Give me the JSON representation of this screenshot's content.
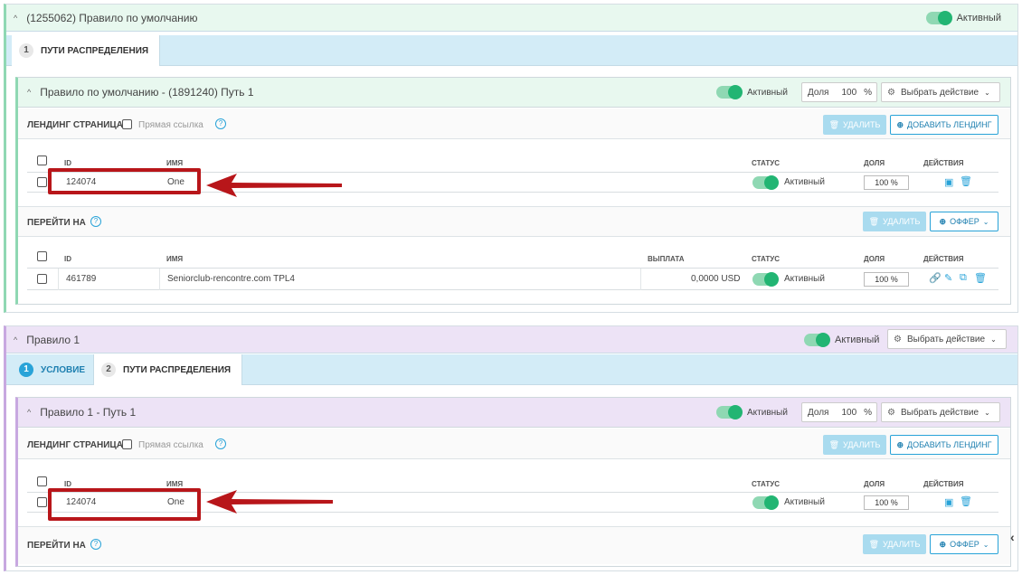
{
  "rule0": {
    "title": "(1255062) Правило по умолчанию",
    "status": "Активный",
    "tab1_num": "1",
    "tab1": "ПУТИ РАСПРЕДЕЛЕНИЯ",
    "path": {
      "title": "Правило по умолчанию - (1891240) Путь 1",
      "status": "Активный",
      "share_label": "Доля",
      "share_value": "100",
      "share_unit": "%",
      "action": "Выбрать действие",
      "landing_label": "ЛЕНДИНГ СТРАНИЦА",
      "direct_link": "Прямая ссылка",
      "delete": "УДАЛИТЬ",
      "add_landing": "ДОБАВИТЬ ЛЕНДИНГ",
      "landing_table": {
        "headers": {
          "id": "ID",
          "name": "ИМЯ",
          "status": "СТАТУС",
          "share": "ДОЛЯ",
          "actions": "ДЕЙСТВИЯ"
        },
        "rows": [
          {
            "id": "124074",
            "name": "One",
            "status": "Активный",
            "share": "100 %"
          }
        ]
      },
      "goto_label": "ПЕРЕЙТИ НА",
      "delete2": "УДАЛИТЬ",
      "offer": "ОФФЕР",
      "offer_table": {
        "headers": {
          "id": "ID",
          "name": "ИМЯ",
          "payout": "ВЫПЛАТА",
          "status": "СТАТУС",
          "share": "ДОЛЯ",
          "actions": "ДЕЙСТВИЯ"
        },
        "rows": [
          {
            "id": "461789",
            "name": "Seniorclub-rencontre.com TPL4",
            "payout": "0,0000 USD",
            "status": "Активный",
            "share": "100 %"
          }
        ]
      }
    }
  },
  "rule1": {
    "title": "Правило 1",
    "status": "Активный",
    "action": "Выбрать действие",
    "tab1_num": "1",
    "tab1": "УСЛОВИЕ",
    "tab2_num": "2",
    "tab2": "ПУТИ РАСПРЕДЕЛЕНИЯ",
    "path": {
      "title": "Правило 1 - Путь 1",
      "status": "Активный",
      "share_label": "Доля",
      "share_value": "100",
      "share_unit": "%",
      "action": "Выбрать действие",
      "landing_label": "ЛЕНДИНГ СТРАНИЦА",
      "direct_link": "Прямая ссылка",
      "delete": "УДАЛИТЬ",
      "add_landing": "ДОБАВИТЬ ЛЕНДИНГ",
      "landing_table": {
        "headers": {
          "id": "ID",
          "name": "ИМЯ",
          "status": "СТАТУС",
          "share": "ДОЛЯ",
          "actions": "ДЕЙСТВИЯ"
        },
        "rows": [
          {
            "id": "124074",
            "name": "One",
            "status": "Активный",
            "share": "100 %"
          }
        ]
      },
      "goto_label": "ПЕРЕЙТИ НА",
      "delete2": "УДАЛИТЬ",
      "offer": "ОФФЕР"
    }
  },
  "colors": {
    "green_header": "#e8f8ef",
    "purple_header": "#ede3f6",
    "tab_bg": "#d3ecf7",
    "accent": "#29a3d8",
    "toggle": "#22b573",
    "arrow": "#b8161a"
  }
}
